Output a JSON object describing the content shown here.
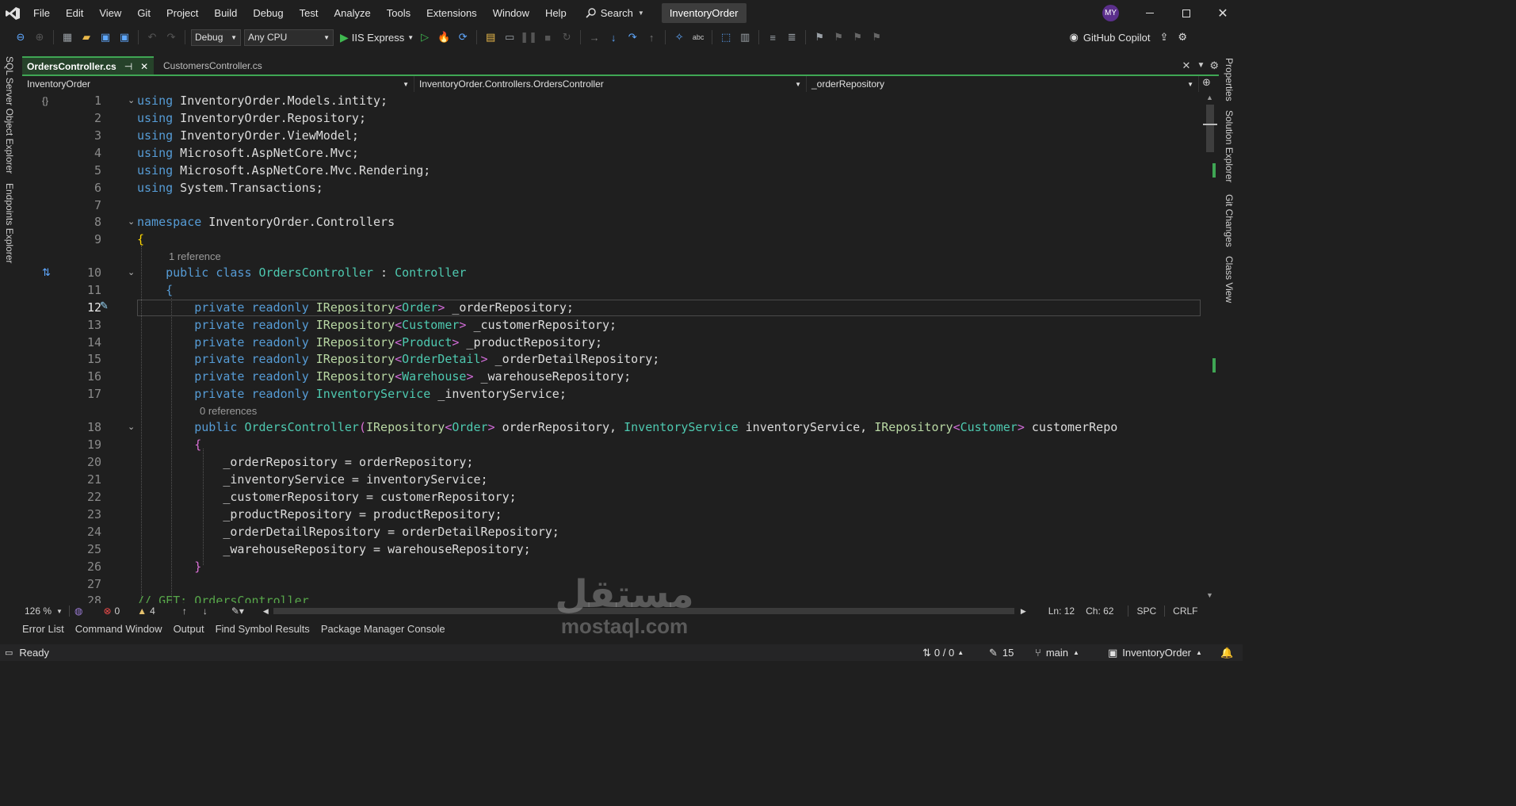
{
  "app": {
    "solution_name": "InventoryOrder",
    "avatar_initials": "MY",
    "accent": "#3fa654"
  },
  "menu": [
    "File",
    "Edit",
    "View",
    "Git",
    "Project",
    "Build",
    "Debug",
    "Test",
    "Analyze",
    "Tools",
    "Extensions",
    "Window",
    "Help"
  ],
  "search": {
    "label": "Search"
  },
  "toolbar": {
    "configuration": "Debug",
    "platform": "Any CPU",
    "run_target": "IIS Express",
    "copilot_label": "GitHub Copilot"
  },
  "left_tabs": [
    "SQL Server Object Explorer",
    "Endpoints Explorer"
  ],
  "right_tabs": [
    "Properties",
    "Solution Explorer",
    "Git Changes",
    "Class View"
  ],
  "tabs": [
    {
      "label": "OrdersController.cs",
      "active": true
    },
    {
      "label": "CustomersController.cs",
      "active": false
    }
  ],
  "navbar": {
    "project": "InventoryOrder",
    "type": "InventoryOrder.Controllers.OrdersController",
    "member": "_orderRepository"
  },
  "code": {
    "line_numbers": [
      "1",
      "2",
      "3",
      "4",
      "5",
      "6",
      "7",
      "8",
      "9",
      "10",
      "11",
      "12",
      "13",
      "14",
      "15",
      "16",
      "17",
      "18",
      "19",
      "20",
      "21",
      "22",
      "23",
      "24",
      "25",
      "26",
      "27",
      "28"
    ],
    "codelens_1": "1 reference",
    "codelens_2": "0 references",
    "comment_28": "// GET: OrdersController"
  },
  "editor_status": {
    "zoom": "126 %",
    "errors": "0",
    "warnings": "4",
    "line": "Ln: 12",
    "col": "Ch: 62",
    "whitespace": "SPC",
    "line_ending": "CRLF"
  },
  "tool_tabs": [
    "Error List",
    "Command Window",
    "Output",
    "Find Symbol Results",
    "Package Manager Console"
  ],
  "status": {
    "ready": "Ready",
    "sync": "0 / 0",
    "pending": "15",
    "branch": "main",
    "repo": "InventoryOrder"
  },
  "watermark": {
    "arabic": "مستقل",
    "latin": "mostaql.com"
  }
}
